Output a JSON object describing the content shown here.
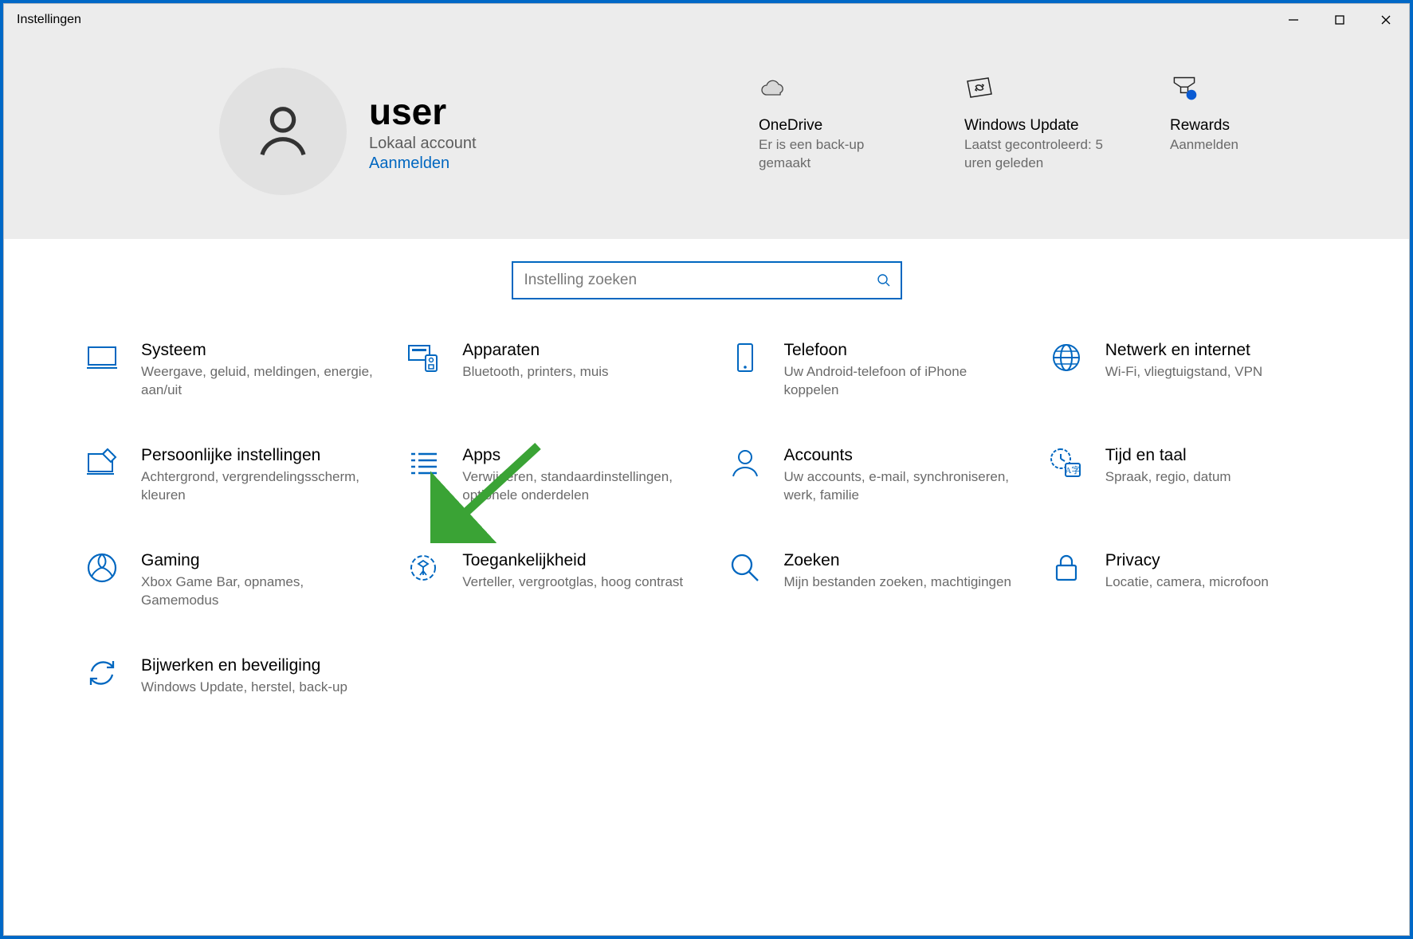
{
  "window": {
    "title": "Instellingen"
  },
  "user": {
    "name": "user",
    "account_type": "Lokaal account",
    "login_link": "Aanmelden"
  },
  "header_tiles": {
    "onedrive": {
      "title": "OneDrive",
      "subtitle": "Er is een back-up gemaakt"
    },
    "update": {
      "title": "Windows Update",
      "subtitle": "Laatst gecontroleerd: 5 uren geleden"
    },
    "rewards": {
      "title": "Rewards",
      "subtitle": "Aanmelden"
    }
  },
  "search": {
    "placeholder": "Instelling zoeken"
  },
  "categories": {
    "system": {
      "title": "Systeem",
      "subtitle": "Weergave, geluid, meldingen, energie, aan/uit"
    },
    "devices": {
      "title": "Apparaten",
      "subtitle": "Bluetooth, printers, muis"
    },
    "phone": {
      "title": "Telefoon",
      "subtitle": "Uw Android-telefoon of iPhone koppelen"
    },
    "network": {
      "title": "Netwerk en internet",
      "subtitle": "Wi-Fi, vliegtuigstand, VPN"
    },
    "personal": {
      "title": "Persoonlijke instellingen",
      "subtitle": "Achtergrond, vergrendelingsscherm, kleuren"
    },
    "apps": {
      "title": "Apps",
      "subtitle": "Verwijderen, standaardinstellingen, optionele onderdelen"
    },
    "accounts": {
      "title": "Accounts",
      "subtitle": "Uw accounts, e-mail, synchroniseren, werk, familie"
    },
    "time": {
      "title": "Tijd en taal",
      "subtitle": "Spraak, regio, datum"
    },
    "gaming": {
      "title": "Gaming",
      "subtitle": "Xbox Game Bar, opnames, Gamemodus"
    },
    "access": {
      "title": "Toegankelijkheid",
      "subtitle": "Verteller, vergrootglas, hoog contrast"
    },
    "searchc": {
      "title": "Zoeken",
      "subtitle": "Mijn bestanden zoeken, machtigingen"
    },
    "privacy": {
      "title": "Privacy",
      "subtitle": "Locatie, camera, microfoon"
    },
    "update": {
      "title": "Bijwerken en beveiliging",
      "subtitle": "Windows Update, herstel, back-up"
    }
  },
  "colors": {
    "accent": "#0067c0",
    "green": "#3aa335"
  }
}
